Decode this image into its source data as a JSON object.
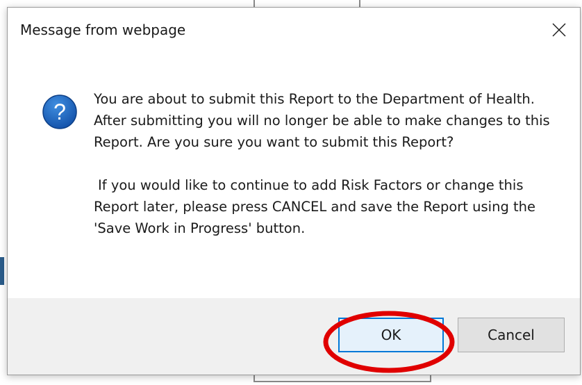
{
  "dialog": {
    "title": "Message from webpage",
    "close_icon": "close-icon",
    "icon": "question-icon",
    "icon_color": "#1565c0",
    "message_paragraphs": [
      "You are about to submit this Report to the Department of Health. After submitting you will no longer be able to make changes to this Report. Are you sure you want to submit this Report?",
      "If you would like to continue to add Risk Factors or change this Report later, please press CANCEL and save the Report using the 'Save Work in Progress' button."
    ],
    "ok_label": "OK",
    "cancel_label": "Cancel"
  },
  "annotation": {
    "highlight_color": "#e00000",
    "highlight_target": "ok-button"
  }
}
